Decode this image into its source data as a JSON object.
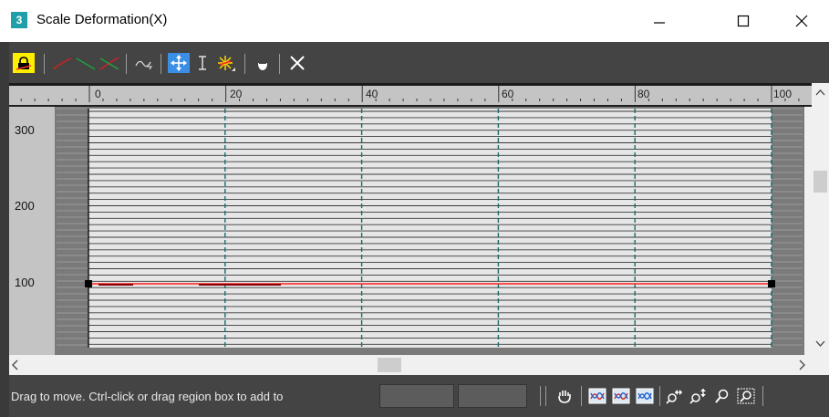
{
  "window": {
    "title": "Scale Deformation(X)",
    "app_icon_label": "3"
  },
  "toolbar": {
    "buttons": [
      {
        "name": "make-symmetrical-icon",
        "active": true
      },
      {
        "name": "display-x-axis-icon"
      },
      {
        "name": "display-y-axis-icon"
      },
      {
        "name": "display-xy-axes-icon"
      },
      {
        "name": "swap-deform-curves-icon"
      },
      {
        "name": "move-control-point-icon",
        "active": true
      },
      {
        "name": "scale-control-point-icon"
      },
      {
        "name": "insert-corner-point-icon"
      },
      {
        "name": "delete-control-point-icon"
      },
      {
        "name": "reset-curve-icon"
      }
    ]
  },
  "ruler": {
    "labels": [
      "0",
      "20",
      "40",
      "60",
      "80",
      "100"
    ]
  },
  "y_axis": {
    "labels": [
      "300",
      "200",
      "100"
    ]
  },
  "curve": {
    "x": [
      0,
      100
    ],
    "y": [
      100,
      100
    ],
    "color": "#ff2020"
  },
  "status": {
    "message": "Drag to move. Ctrl-click or drag region box to add to",
    "field1_value": "",
    "field2_value": ""
  },
  "statusbar_buttons": [
    "pan-hand-icon",
    "zoom-extents-icon",
    "zoom-horizontal-extents-icon",
    "zoom-vertical-extents-icon",
    "zoom-horizontal-icon",
    "zoom-vertical-icon",
    "zoom-icon",
    "zoom-region-icon"
  ],
  "colors": {
    "toolbar_bg": "#444444",
    "graph_bg": "#e6e6e6",
    "curve": "#ff2020",
    "active_button": "#3a8ee6",
    "highlight_button": "#ffee00"
  }
}
